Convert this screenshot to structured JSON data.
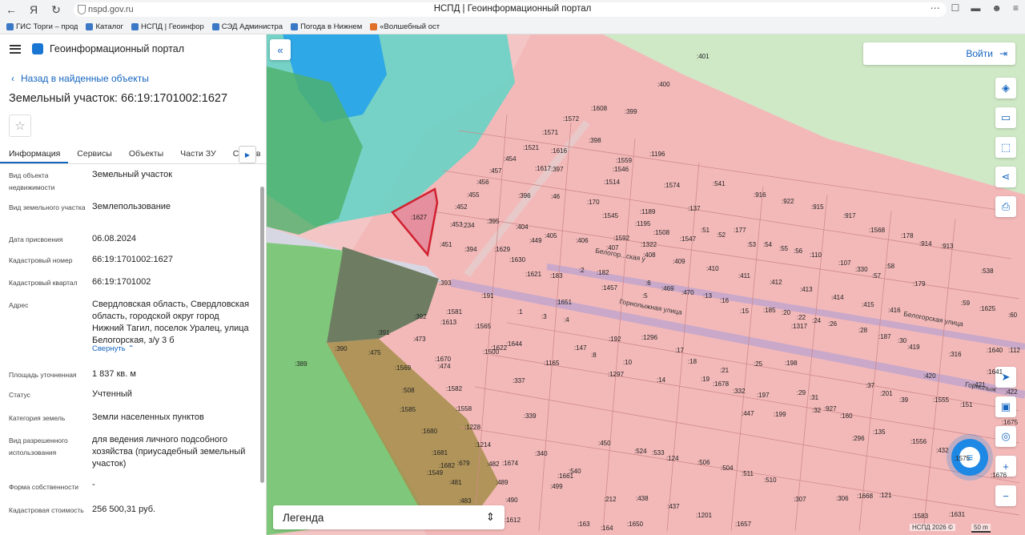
{
  "browser": {
    "url": "nspd.gov.ru",
    "tab_title": "НСПД | Геоинформационный портал",
    "bookmarks": [
      "ГИС Торги – прод",
      "Каталог",
      "НСПД | Геоинфор",
      "СЭД Администра",
      "Погода в Нижнем",
      "«Волшебный ост"
    ]
  },
  "panel": {
    "portal_title": "Геоинформационный портал",
    "back_label": "Назад в найденные объекты",
    "object_title": "Земельный участок: 66:19:1701002:1627",
    "tabs": [
      "Информация",
      "Сервисы",
      "Объекты",
      "Части ЗУ",
      "Состав"
    ],
    "props": [
      {
        "label": "Вид объекта недвижимости",
        "value": "Земельный участок"
      },
      {
        "label": "Вид земельного участка",
        "value": "Землепользование"
      },
      {
        "label": "Дата присвоения",
        "value": "06.08.2024"
      },
      {
        "label": "Кадастровый номер",
        "value": "66:19:1701002:1627"
      },
      {
        "label": "Кадастровый квартал",
        "value": "66:19:1701002"
      },
      {
        "label": "Адрес",
        "value": "Свердловская область, Свердловская область, городской округ город Нижний Тагил, поселок Уралец, улица Белогорская, з/у 3 б"
      },
      {
        "label": "Площадь уточненная",
        "value": "1 837 кв. м"
      },
      {
        "label": "Статус",
        "value": "Учтенный"
      },
      {
        "label": "Категория земель",
        "value": "Земли населенных пунктов"
      },
      {
        "label": "Вид разрешенного использования",
        "value": "для ведения личного подсобного хозяйства (приусадебный земельный участок)"
      },
      {
        "label": "Форма собственности",
        "value": "-"
      },
      {
        "label": "Кадастровая стоимость",
        "value": "256 500,31 руб."
      }
    ],
    "collapse_label": "Свернуть"
  },
  "map": {
    "login_label": "Войти",
    "legend_label": "Легенда",
    "attribution": "НСПД 2026 ©",
    "scale_label": "50 m",
    "streets": [
      "Горнолыжная улица",
      "Белогорская улица",
      "Белогор...ская у",
      "Горнолыж"
    ],
    "parcel_labels": [
      ":401",
      ":400",
      ":1608",
      ":399",
      ":1572",
      ":1571",
      ":1521",
      ":1616",
      ":398",
      ":1196",
      ":1559",
      ":1546",
      ":454",
      ":1617",
      ":397",
      ":457",
      ":456",
      ":1514",
      ":1574",
      ":455",
      ":452",
      ":396",
      ":46",
      ":170",
      ":1545",
      ":1189",
      ":1195",
      ":1627",
      ":453",
      ":234",
      ":395",
      ":404",
      ":405",
      ":1508",
      ":1547",
      ":137",
      ":51",
      ":52",
      ":177",
      ":53",
      ":54",
      ":55",
      ":56",
      ":110",
      ":394",
      ":1629",
      ":1630",
      ":449",
      ":406",
      ":1592",
      ":407",
      ":1322",
      ":408",
      ":409",
      ":410",
      ":411",
      ":412",
      ":413",
      ":414",
      ":107",
      ":330",
      ":57",
      ":58",
      ":1568",
      ":178",
      ":914",
      ":913",
      ":541",
      ":916",
      ":922",
      ":915",
      ":917",
      ":451",
      ":1621",
      ":183",
      ":2",
      ":182",
      ":6",
      ":469",
      ":470",
      ":13",
      ":16",
      ":15",
      ":185",
      ":20",
      ":22",
      ":24",
      ":26",
      ":415",
      ":416",
      ":179",
      ":538",
      ":59",
      ":1625",
      ":60",
      ":393",
      ":191",
      ":1651",
      ":1457",
      ":5",
      ":1581",
      ":1",
      ":3",
      ":4",
      ":392",
      ":1613",
      ":1565",
      ":1622",
      ":1644",
      ":147",
      ":8",
      ":192",
      ":1296",
      ":17",
      ":18",
      ":19",
      ":21",
      ":25",
      ":198",
      ":1317",
      ":28",
      ":187",
      ":30",
      ":419",
      ":316",
      ":1640",
      ":112",
      ":391",
      ":1500",
      ":473",
      ":390",
      ":475",
      ":1165",
      ":10",
      ":1297",
      ":14",
      ":1678",
      ":332",
      ":197",
      ":29",
      ":31",
      ":37",
      ":201",
      ":39",
      ":420",
      ":421",
      ":1641",
      ":1555",
      ":151",
      ":389",
      ":1670",
      ":474",
      ":1569",
      ":337",
      ":199",
      ":32",
      ":927",
      ":160",
      ":447",
      ":422",
      ":1675",
      ":508",
      ":1582",
      ":1585",
      ":1558",
      ":339",
      ":296",
      ":135",
      ":1556",
      ":1680",
      ":1228",
      ":1214",
      ":450",
      ":524",
      ":533",
      ":124",
      ":506",
      ":504",
      ":511",
      ":510",
      ":432",
      ":1575",
      ":1681",
      ":1682",
      ":679",
      ":482",
      ":1674",
      ":340",
      ":540",
      ":1549",
      ":481",
      ":489",
      ":1661",
      ":499",
      ":212",
      ":438",
      ":437",
      ":1201",
      ":307",
      ":306",
      ":1668",
      ":121",
      ":1676",
      ":483",
      ":490",
      ":1612",
      ":163",
      ":164",
      ":1650",
      ":1657",
      ":1583",
      ":1631"
    ]
  }
}
